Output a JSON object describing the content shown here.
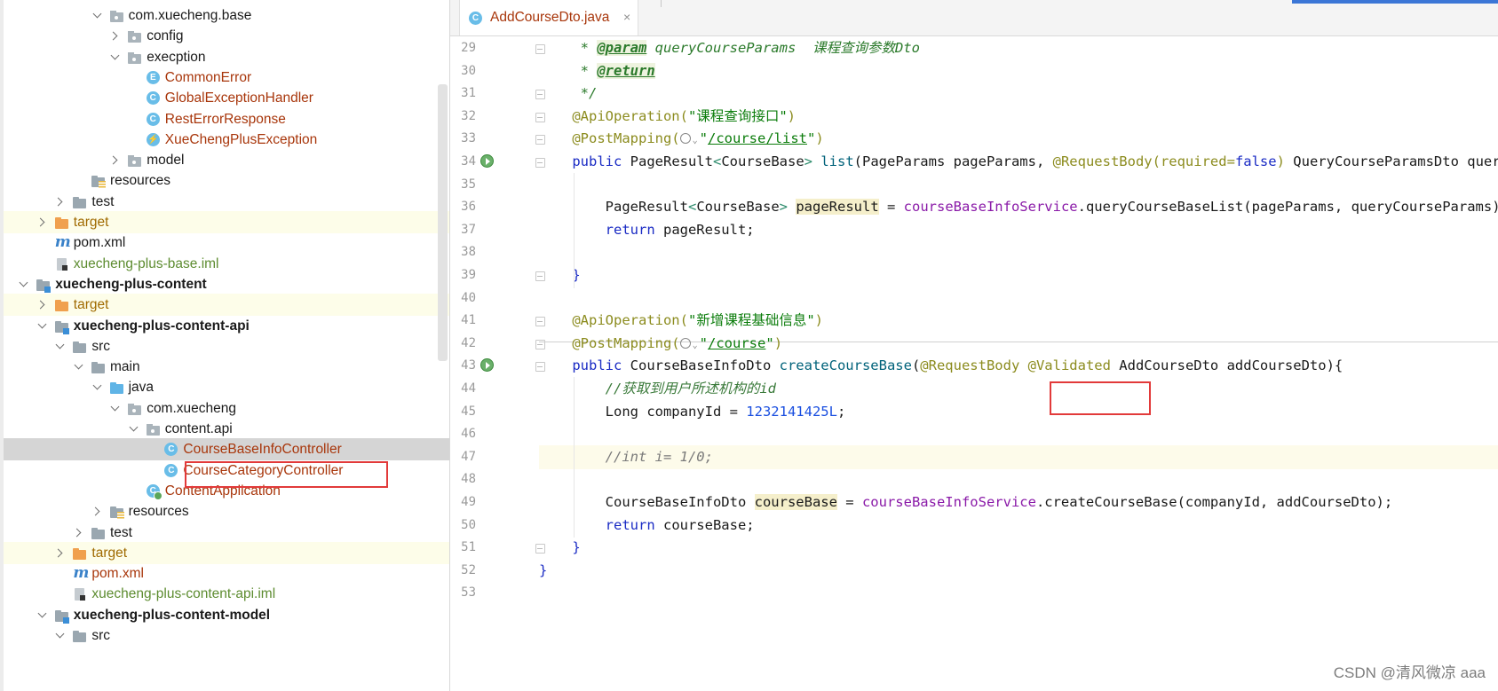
{
  "tree": [
    {
      "label": "com.xuecheng.base",
      "depth": 6,
      "chev": "down",
      "icon": "pkg",
      "style": ""
    },
    {
      "label": "config",
      "depth": 7,
      "chev": "right",
      "icon": "pkg",
      "style": ""
    },
    {
      "label": "execption",
      "depth": 7,
      "chev": "down",
      "icon": "pkg",
      "style": ""
    },
    {
      "label": "CommonError",
      "depth": 8,
      "chev": "",
      "icon": "enum",
      "style": "cls-name"
    },
    {
      "label": "GlobalExceptionHandler",
      "depth": 8,
      "chev": "",
      "icon": "cls",
      "style": "cls-name"
    },
    {
      "label": "RestErrorResponse",
      "depth": 8,
      "chev": "",
      "icon": "cls",
      "style": "cls-name"
    },
    {
      "label": "XueChengPlusException",
      "depth": 8,
      "chev": "",
      "icon": "exc",
      "style": "cls-name"
    },
    {
      "label": "model",
      "depth": 7,
      "chev": "right",
      "icon": "pkg",
      "style": ""
    },
    {
      "label": "resources",
      "depth": 5,
      "chev": "",
      "icon": "res",
      "style": ""
    },
    {
      "label": "test",
      "depth": 4,
      "chev": "right",
      "icon": "folder",
      "style": ""
    },
    {
      "label": "target",
      "depth": 3,
      "chev": "right",
      "icon": "orange",
      "style": "excl",
      "hl": true
    },
    {
      "label": "pom.xml",
      "depth": 3,
      "chev": "",
      "icon": "maven",
      "style": ""
    },
    {
      "label": "xuecheng-plus-base.iml",
      "depth": 3,
      "chev": "",
      "icon": "iml",
      "style": "iml"
    },
    {
      "label": "xuecheng-plus-content",
      "depth": 2,
      "chev": "down",
      "icon": "module",
      "style": "bold"
    },
    {
      "label": "target",
      "depth": 3,
      "chev": "right",
      "icon": "orange",
      "style": "excl",
      "hl": true
    },
    {
      "label": "xuecheng-plus-content-api",
      "depth": 3,
      "chev": "down",
      "icon": "module",
      "style": "bold"
    },
    {
      "label": "src",
      "depth": 4,
      "chev": "down",
      "icon": "folder",
      "style": ""
    },
    {
      "label": "main",
      "depth": 5,
      "chev": "down",
      "icon": "folder",
      "style": ""
    },
    {
      "label": "java",
      "depth": 6,
      "chev": "down",
      "icon": "blue",
      "style": ""
    },
    {
      "label": "com.xuecheng",
      "depth": 7,
      "chev": "down",
      "icon": "pkg",
      "style": ""
    },
    {
      "label": "content.api",
      "depth": 8,
      "chev": "down",
      "icon": "pkg",
      "style": ""
    },
    {
      "label": "CourseBaseInfoController",
      "depth": 9,
      "chev": "",
      "icon": "cls",
      "style": "cls-name",
      "sel": true
    },
    {
      "label": "CourseCategoryController",
      "depth": 9,
      "chev": "",
      "icon": "cls",
      "style": "cls-name"
    },
    {
      "label": "ContentApplication",
      "depth": 8,
      "chev": "",
      "icon": "app",
      "style": "cls-name"
    },
    {
      "label": "resources",
      "depth": 6,
      "chev": "right",
      "icon": "res",
      "style": ""
    },
    {
      "label": "test",
      "depth": 5,
      "chev": "right",
      "icon": "folder",
      "style": ""
    },
    {
      "label": "target",
      "depth": 4,
      "chev": "right",
      "icon": "orange",
      "style": "excl",
      "hl": true
    },
    {
      "label": "pom.xml",
      "depth": 4,
      "chev": "",
      "icon": "maven",
      "style": "cls-name"
    },
    {
      "label": "xuecheng-plus-content-api.iml",
      "depth": 4,
      "chev": "",
      "icon": "iml",
      "style": "iml"
    },
    {
      "label": "xuecheng-plus-content-model",
      "depth": 3,
      "chev": "down",
      "icon": "module",
      "style": "bold"
    },
    {
      "label": "src",
      "depth": 4,
      "chev": "down",
      "icon": "folder",
      "style": ""
    }
  ],
  "tab": {
    "label": "AddCourseDto.java",
    "close": "×",
    "icon": "class-icon"
  },
  "code": {
    "lines": [
      {
        "n": "29",
        "fold": true,
        "tokens": [
          [
            "t-doc",
            "     * "
          ],
          [
            "t-tag",
            "@param"
          ],
          [
            "t-doc",
            " queryCourseParams  课程查询参数Dto"
          ]
        ]
      },
      {
        "n": "30",
        "tokens": [
          [
            "t-doc",
            "     * "
          ],
          [
            "t-tag",
            "@return"
          ]
        ]
      },
      {
        "n": "31",
        "fold": true,
        "tokens": [
          [
            "t-doc",
            "     */"
          ]
        ]
      },
      {
        "n": "32",
        "fold": true,
        "tokens": [
          [
            "t-ann",
            "    @ApiOperation("
          ],
          [
            "t-str",
            "\"课程查询接口\""
          ],
          [
            "t-ann",
            ")"
          ]
        ]
      },
      {
        "n": "33",
        "fold": true,
        "tokens": [
          [
            "t-ann",
            "    @PostMapping("
          ],
          [
            "globe",
            ""
          ],
          [
            "t-str",
            "\""
          ],
          [
            "t-url",
            "/course/list"
          ],
          [
            "t-str",
            "\""
          ],
          [
            "t-ann",
            ")"
          ]
        ]
      },
      {
        "n": "34",
        "run": true,
        "fold": true,
        "tokens": [
          [
            "t-kw",
            "    public "
          ],
          [
            "",
            "PageResult"
          ],
          [
            "t-gen",
            "<"
          ],
          [
            "",
            "CourseBase"
          ],
          [
            "t-gen",
            "> "
          ],
          [
            "t-mth",
            "list"
          ],
          [
            "",
            "(PageParams pageParams, "
          ],
          [
            "t-ann",
            "@RequestBody"
          ],
          [
            "t-ann",
            "(required="
          ],
          [
            "t-kw",
            "false"
          ],
          [
            "t-ann",
            ")"
          ],
          [
            "",
            " QueryCourseParamsDto queryCourseParams){"
          ]
        ]
      },
      {
        "n": "35",
        "tokens": [
          [
            "",
            ""
          ]
        ]
      },
      {
        "n": "36",
        "tokens": [
          [
            "",
            "        PageResult"
          ],
          [
            "t-gen",
            "<"
          ],
          [
            "",
            "CourseBase"
          ],
          [
            "t-gen",
            "> "
          ],
          [
            "t-var",
            "pageResult"
          ],
          [
            "",
            " = "
          ],
          [
            "t-fld",
            "courseBaseInfoService"
          ],
          [
            "",
            ".queryCourseBaseList(pageParams, queryCourseParams);"
          ]
        ]
      },
      {
        "n": "37",
        "tokens": [
          [
            "t-kw",
            "        return "
          ],
          [
            "",
            "pageResult;"
          ]
        ]
      },
      {
        "n": "38",
        "tokens": [
          [
            "",
            ""
          ]
        ]
      },
      {
        "n": "39",
        "fold": true,
        "tokens": [
          [
            "t-kw",
            "    }"
          ]
        ]
      },
      {
        "n": "40",
        "tokens": [
          [
            "",
            ""
          ]
        ]
      },
      {
        "n": "41",
        "fold": true,
        "tokens": [
          [
            "t-ann",
            "    @ApiOperation("
          ],
          [
            "t-str",
            "\"新增课程基础信息\""
          ],
          [
            "t-ann",
            ")"
          ]
        ]
      },
      {
        "n": "42",
        "fold": true,
        "tokens": [
          [
            "t-ann",
            "    @PostMapping("
          ],
          [
            "globe",
            ""
          ],
          [
            "t-str",
            "\""
          ],
          [
            "t-url",
            "/course"
          ],
          [
            "t-str",
            "\""
          ],
          [
            "t-ann",
            ")"
          ]
        ]
      },
      {
        "n": "43",
        "run": true,
        "fold": true,
        "tokens": [
          [
            "t-kw",
            "    public "
          ],
          [
            "",
            "CourseBaseInfoDto "
          ],
          [
            "t-mth",
            "createCourseBase"
          ],
          [
            "",
            "("
          ],
          [
            "t-ann",
            "@RequestBody"
          ],
          [
            "",
            " "
          ],
          [
            "t-ann",
            "@Validated"
          ],
          [
            "",
            " AddCourseDto addCourseDto){"
          ]
        ]
      },
      {
        "n": "44",
        "tokens": [
          [
            "t-cmg",
            "        //获取到用户所述机构的id"
          ]
        ]
      },
      {
        "n": "45",
        "tokens": [
          [
            "",
            "        Long companyId = "
          ],
          [
            "t-num",
            "1232141425L"
          ],
          [
            "",
            ";"
          ]
        ]
      },
      {
        "n": "46",
        "tokens": [
          [
            "",
            ""
          ]
        ]
      },
      {
        "n": "47",
        "cur": true,
        "tokens": [
          [
            "t-cm",
            "        //int i= 1/0;"
          ]
        ]
      },
      {
        "n": "48",
        "tokens": [
          [
            "",
            ""
          ]
        ]
      },
      {
        "n": "49",
        "tokens": [
          [
            "",
            "        CourseBaseInfoDto "
          ],
          [
            "t-var",
            "courseBase"
          ],
          [
            "",
            " = "
          ],
          [
            "t-fld",
            "courseBaseInfoService"
          ],
          [
            "",
            ".createCourseBase(companyId, addCourseDto);"
          ]
        ]
      },
      {
        "n": "50",
        "tokens": [
          [
            "t-kw",
            "        return "
          ],
          [
            "",
            "courseBase;"
          ]
        ]
      },
      {
        "n": "51",
        "fold": true,
        "tokens": [
          [
            "t-kw",
            "    }"
          ]
        ]
      },
      {
        "n": "52",
        "tokens": [
          [
            "t-kw",
            "}"
          ]
        ]
      },
      {
        "n": "53",
        "tokens": [
          [
            "",
            ""
          ]
        ]
      }
    ]
  },
  "watermark": "CSDN @清风微凉 aaa",
  "colors": {
    "selection_box": "#e23a3a",
    "class_name": "#a8360b",
    "excluded": "#a06a00"
  }
}
